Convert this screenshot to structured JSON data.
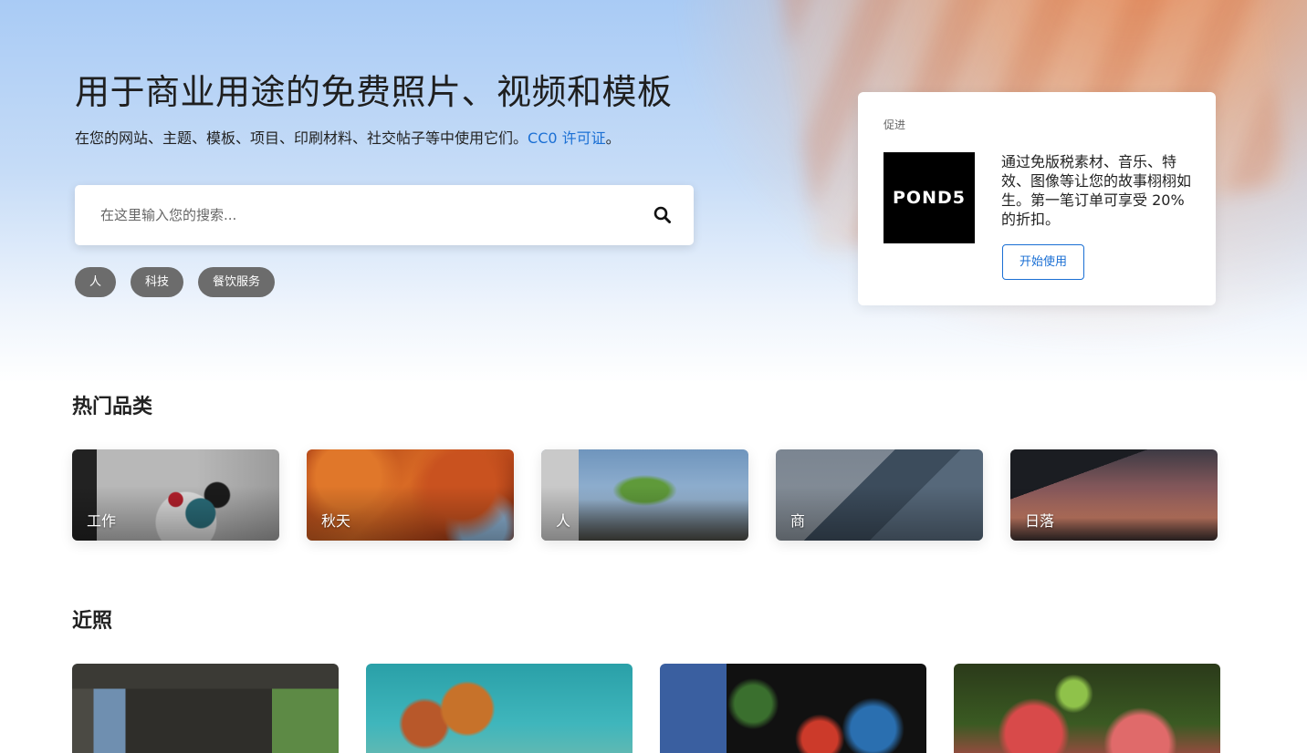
{
  "hero": {
    "title": "用于商业用途的免费照片、视频和模板",
    "subtitle": "在您的网站、主题、模板、项目、印刷材料、社交帖子等中使用它们。",
    "license_link": "CC0 许可证",
    "subtitle_end": "。",
    "search_placeholder": "在这里输入您的搜索...",
    "chips": [
      "人",
      "科技",
      "餐饮服务"
    ]
  },
  "promo": {
    "label": "促进",
    "logo_text": "POND5",
    "text": "通过免版税素材、音乐、特效、图像等让您的故事栩栩如生。第一笔订单可享受 20% 的折扣。",
    "button": "开始使用"
  },
  "popular": {
    "title": "热门品类",
    "items": [
      {
        "label": "工作"
      },
      {
        "label": "秋天"
      },
      {
        "label": "人"
      },
      {
        "label": "商"
      },
      {
        "label": "日落"
      }
    ]
  },
  "recent": {
    "title": "近照"
  },
  "colors": {
    "accent": "#1a6fd4",
    "chip_bg": "#6c6c6c"
  }
}
